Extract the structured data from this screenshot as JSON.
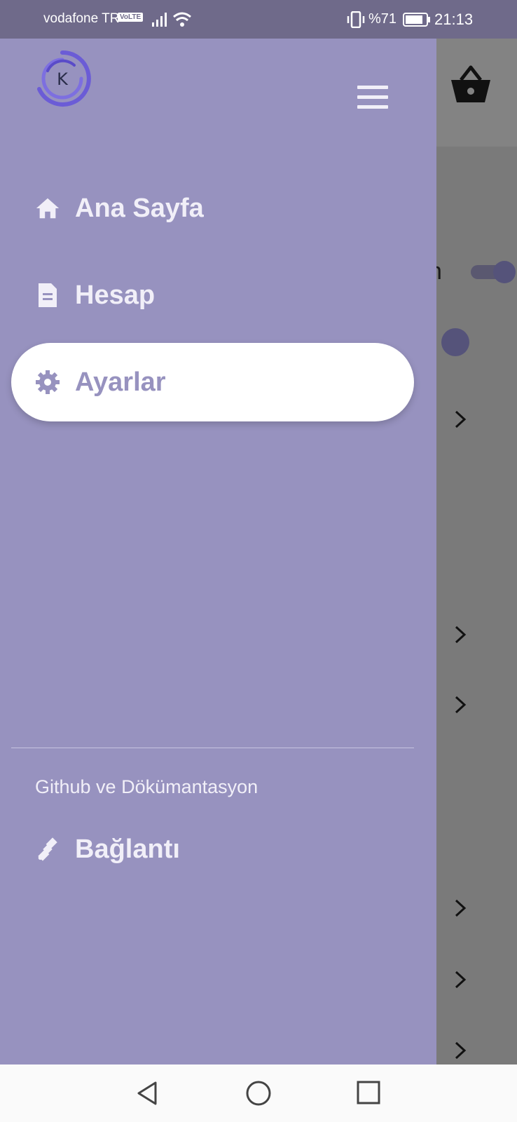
{
  "status_bar": {
    "carrier": "vodafone TR",
    "volte": "VoLTE",
    "battery_percent": "%71",
    "time": "21:13"
  },
  "drawer": {
    "logo_letter": "K",
    "menu_items": [
      {
        "label": "Ana Sayfa",
        "icon": "home-icon"
      },
      {
        "label": "Hesap",
        "icon": "document-icon"
      },
      {
        "label": "Ayarlar",
        "icon": "gear-icon",
        "selected": true
      }
    ],
    "section_caption": "Github ve Dökümantasyon",
    "link_item": {
      "label": "Bağlantı",
      "icon": "satellite-icon"
    }
  },
  "background": {
    "partial_letter": "n"
  },
  "colors": {
    "drawer_bg": "#9792bf",
    "selected_bg": "#ffffff",
    "status_bar_bg": "#6f6a8a",
    "scrim": "#7a7a7a"
  }
}
